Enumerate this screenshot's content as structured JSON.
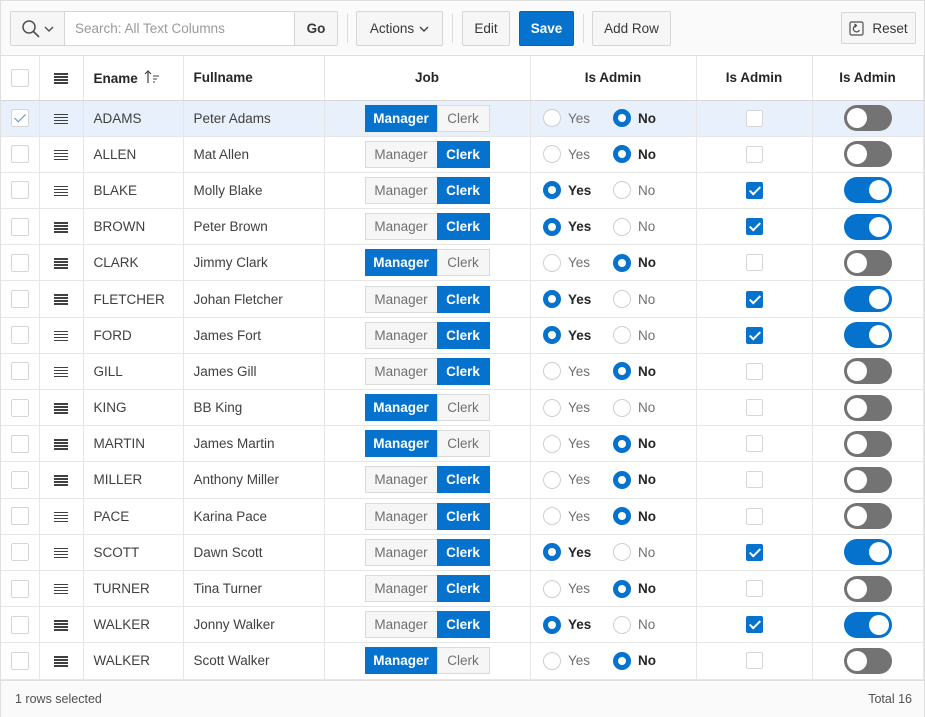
{
  "toolbar": {
    "search_placeholder": "Search: All Text Columns",
    "go_label": "Go",
    "actions_label": "Actions",
    "edit_label": "Edit",
    "save_label": "Save",
    "add_row_label": "Add Row",
    "reset_label": "Reset"
  },
  "columns": {
    "ename": "Ename",
    "fullname": "Fullname",
    "job": "Job",
    "is_admin_1": "Is Admin",
    "is_admin_2": "Is Admin",
    "is_admin_3": "Is Admin"
  },
  "job_options": {
    "manager": "Manager",
    "clerk": "Clerk"
  },
  "radio_options": {
    "yes": "Yes",
    "no": "No"
  },
  "rows": [
    {
      "ename": "ADAMS",
      "fullname": "Peter Adams",
      "job": "Manager",
      "admin_radio": "No",
      "admin": false,
      "selected": true
    },
    {
      "ename": "ALLEN",
      "fullname": "Mat Allen",
      "job": "Clerk",
      "admin_radio": "No",
      "admin": false,
      "selected": false
    },
    {
      "ename": "BLAKE",
      "fullname": "Molly Blake",
      "job": "Clerk",
      "admin_radio": "Yes",
      "admin": true,
      "selected": false
    },
    {
      "ename": "BROWN",
      "fullname": "Peter Brown",
      "job": "Clerk",
      "admin_radio": "Yes",
      "admin": true,
      "selected": false
    },
    {
      "ename": "CLARK",
      "fullname": "Jimmy Clark",
      "job": "Manager",
      "admin_radio": "No",
      "admin": false,
      "selected": false
    },
    {
      "ename": "FLETCHER",
      "fullname": "Johan Fletcher",
      "job": "Clerk",
      "admin_radio": "Yes",
      "admin": true,
      "selected": false
    },
    {
      "ename": "FORD",
      "fullname": "James Fort",
      "job": "Clerk",
      "admin_radio": "Yes",
      "admin": true,
      "selected": false
    },
    {
      "ename": "GILL",
      "fullname": "James Gill",
      "job": "Clerk",
      "admin_radio": "No",
      "admin": false,
      "selected": false
    },
    {
      "ename": "KING",
      "fullname": "BB King",
      "job": "Manager",
      "admin_radio": "",
      "admin": false,
      "selected": false
    },
    {
      "ename": "MARTIN",
      "fullname": "James Martin",
      "job": "Manager",
      "admin_radio": "No",
      "admin": false,
      "selected": false
    },
    {
      "ename": "MILLER",
      "fullname": "Anthony Miller",
      "job": "Clerk",
      "admin_radio": "No",
      "admin": false,
      "selected": false
    },
    {
      "ename": "PACE",
      "fullname": "Karina Pace",
      "job": "Clerk",
      "admin_radio": "No",
      "admin": false,
      "selected": false
    },
    {
      "ename": "SCOTT",
      "fullname": "Dawn Scott",
      "job": "Clerk",
      "admin_radio": "Yes",
      "admin": true,
      "selected": false
    },
    {
      "ename": "TURNER",
      "fullname": "Tina Turner",
      "job": "Clerk",
      "admin_radio": "No",
      "admin": false,
      "selected": false
    },
    {
      "ename": "WALKER",
      "fullname": "Jonny Walker",
      "job": "Clerk",
      "admin_radio": "Yes",
      "admin": true,
      "selected": false
    },
    {
      "ename": "WALKER",
      "fullname": "Scott Walker",
      "job": "Manager",
      "admin_radio": "No",
      "admin": false,
      "selected": false
    }
  ],
  "footer": {
    "selection_status": "1 rows selected",
    "total": "Total 16"
  },
  "icons": {
    "search": "search-icon",
    "menu": "row-menu-icon",
    "sort": "sort-ascending-icon",
    "reset": "reset-icon"
  },
  "colors": {
    "accent": "#0572ce",
    "toggle_off": "#737373",
    "selected_row": "#e8f1fb"
  }
}
